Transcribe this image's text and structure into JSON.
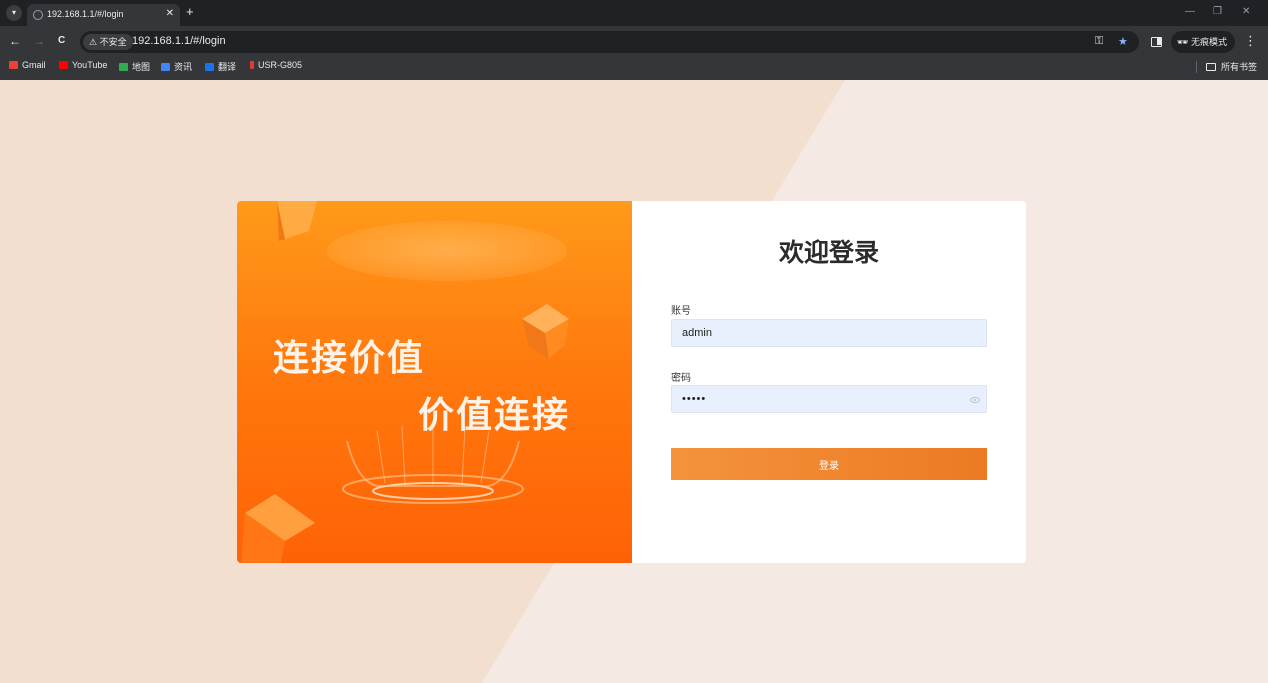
{
  "browser": {
    "tab": {
      "title": "192.168.1.1/#/login",
      "close": "✕"
    },
    "new_tab": "+",
    "window_controls": {
      "minimize": "—",
      "restore": "❐",
      "close": "✕"
    },
    "nav": {
      "back": "←",
      "forward": "→",
      "reload": "C"
    },
    "address": {
      "security_label": "⚠ 不安全",
      "url": "192.168.1.1/#/login"
    },
    "omnibox_icons": {
      "key": "⚿",
      "bookmark_star": "★"
    },
    "incognito": {
      "label": "无痕模式"
    },
    "menu": "⋮",
    "bookmarks": [
      {
        "label": "Gmail",
        "color": "#ea4335"
      },
      {
        "label": "YouTube",
        "color": "#ff0000"
      },
      {
        "label": "地图",
        "color": "#34a853"
      },
      {
        "label": "资讯",
        "color": "#4285f4"
      },
      {
        "label": "翻译",
        "color": "#1a73e8"
      },
      {
        "label": "USR-G805",
        "color": "#e53935"
      }
    ],
    "all_bookmarks": "所有书签"
  },
  "promo": {
    "line1": "连接价值",
    "line2": "价值连接"
  },
  "login": {
    "title": "欢迎登录",
    "account_label": "账号",
    "account_value": "admin",
    "password_label": "密码",
    "password_value": "•••••",
    "submit_label": "登录"
  },
  "colors": {
    "accent": "#ff7a0e",
    "button": "#f08a30",
    "input_bg": "#e8f0fe",
    "page_bg": "#f5e9e4",
    "page_bg_left": "#f3dfd0"
  }
}
